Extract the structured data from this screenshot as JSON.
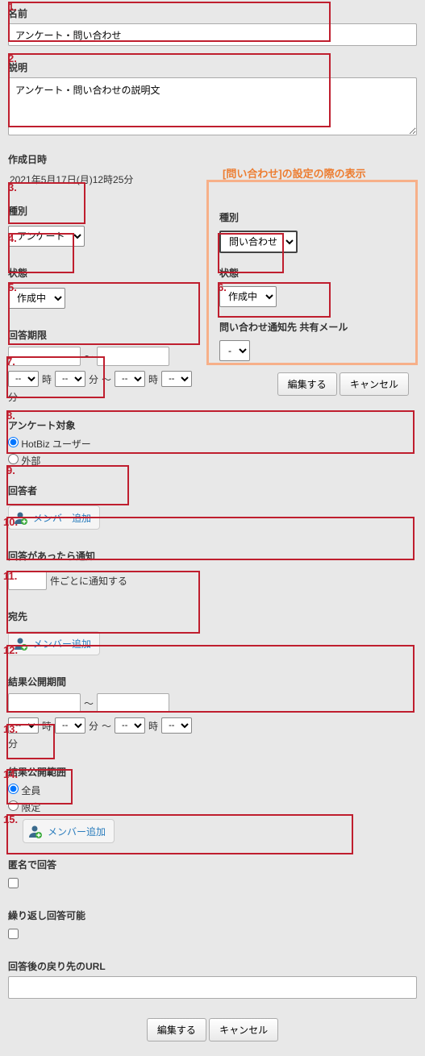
{
  "name": {
    "label": "名前",
    "value": "アンケート・問い合わせ"
  },
  "desc": {
    "label": "説明",
    "value": "アンケート・問い合わせの説明文"
  },
  "created": {
    "label": "作成日時",
    "value": "2021年5月17日(月)12時25分"
  },
  "type": {
    "label": "種別",
    "value": "アンケート"
  },
  "status": {
    "label": "状態",
    "value": "作成中"
  },
  "deadline": {
    "label": "回答期限",
    "sep": "～",
    "hour": "時",
    "min": "分",
    "dash": "--"
  },
  "target": {
    "label": "アンケート対象",
    "opt1": "HotBiz ユーザー",
    "opt2": "外部"
  },
  "responder": {
    "label": "回答者",
    "btn": "メンバー追加"
  },
  "notify": {
    "label": "回答があったら通知",
    "suffix": "件ごとに通知する"
  },
  "dest": {
    "label": "宛先",
    "btn": "メンバー追加"
  },
  "pubperiod": {
    "label": "結果公開期間",
    "sep": "～",
    "hour": "時",
    "min": "分",
    "dash": "--"
  },
  "pubscope": {
    "label": "結果公開範囲",
    "opt1": "全員",
    "opt2": "限定",
    "btn": "メンバー追加"
  },
  "anon": {
    "label": "匿名で回答"
  },
  "repeat": {
    "label": "繰り返し回答可能"
  },
  "returnurl": {
    "label": "回答後の戻り先のURL"
  },
  "buttons": {
    "edit": "編集する",
    "cancel": "キャンセル"
  },
  "callout": {
    "title": "[問い合わせ]の設定の際の表示",
    "type_label": "種別",
    "type_value": "問い合わせ",
    "status_label": "状態",
    "status_value": "作成中",
    "dest_label": "問い合わせ通知先 共有メール",
    "dest_value": "-",
    "edit": "編集する",
    "cancel": "キャンセル"
  },
  "nums": {
    "n1": "1.",
    "n2": "2.",
    "n3": "3.",
    "n4": "4.",
    "n5": "5.",
    "n6": "6.",
    "n7": "7.",
    "n8": "8.",
    "n9": "9.",
    "n10": "10.",
    "n11": "11.",
    "n12": "12.",
    "n13": "13.",
    "n14": "14.",
    "n15": "15."
  }
}
